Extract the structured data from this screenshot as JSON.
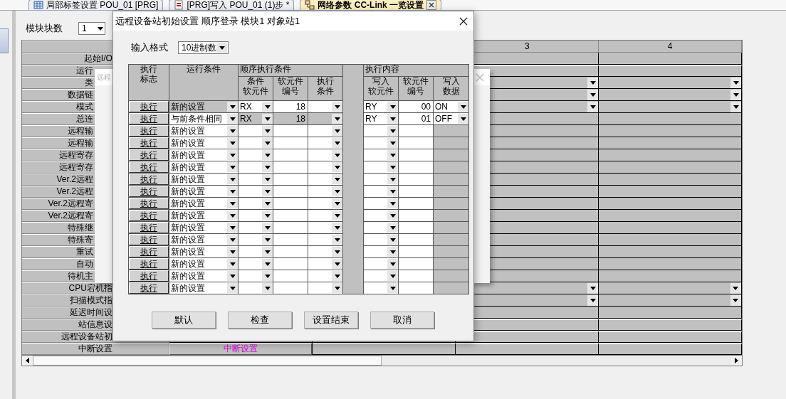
{
  "tabs": [
    {
      "label": "局部标签设置 POU_01 [PRG]",
      "kind": "table",
      "selected": false
    },
    {
      "label": "[PRG]写入 POU_01 (1)步 *",
      "kind": "program",
      "selected": false
    },
    {
      "label": "网络参数 CC-Link 一览设置",
      "kind": "network",
      "selected": true
    }
  ],
  "module_count": {
    "label": "模块块数",
    "value": "1"
  },
  "grid": {
    "station_columns": [
      "3",
      "4"
    ],
    "rows": [
      {
        "label": "起始I/O",
        "kind": "plain"
      },
      {
        "label": "运行",
        "kind": "button"
      },
      {
        "label": "类",
        "kind": "dropdown"
      },
      {
        "label": "数据链",
        "kind": "dropdown"
      },
      {
        "label": "模式",
        "kind": "dropdown"
      },
      {
        "label": "总连",
        "kind": "plain"
      },
      {
        "label": "远程输",
        "kind": "plain"
      },
      {
        "label": "远程输",
        "kind": "plain"
      },
      {
        "label": "远程寄存",
        "kind": "plain"
      },
      {
        "label": "远程寄存",
        "kind": "plain"
      },
      {
        "label": "Ver.2远程",
        "kind": "plain"
      },
      {
        "label": "Ver.2远程",
        "kind": "plain"
      },
      {
        "label": "Ver.2远程寄",
        "kind": "plain"
      },
      {
        "label": "Ver.2远程寄",
        "kind": "plain"
      },
      {
        "label": "特殊继",
        "kind": "plain"
      },
      {
        "label": "特殊寄",
        "kind": "plain"
      },
      {
        "label": "重试",
        "kind": "plain"
      },
      {
        "label": "自动",
        "kind": "plain"
      },
      {
        "label": "待机主",
        "kind": "plain"
      },
      {
        "label": "CPU宕机指",
        "kind": "dropdown"
      },
      {
        "label": "扫描模式指",
        "kind": "dropdown"
      },
      {
        "label": "延迟时间设",
        "kind": "plain"
      },
      {
        "label": "站信息设",
        "kind": "button"
      },
      {
        "label": "远程设备站初",
        "kind": "button"
      },
      {
        "label": "中断设置",
        "kind": "button",
        "link": "中断设置"
      }
    ]
  },
  "background_dialog": {
    "title": "远程"
  },
  "dialog": {
    "title": "远程设备站初始设置 顺序登录  模块1 对象站1",
    "input_format": {
      "label": "输入格式",
      "value": "10进制数"
    },
    "headers": {
      "flag": [
        "执行",
        "标志"
      ],
      "run_condition": [
        "运行条件"
      ],
      "sequence": [
        "顺序执行条件"
      ],
      "cond_device": [
        "条件",
        "软元件"
      ],
      "cond_number": [
        "软元件",
        "编号"
      ],
      "exec_condition": [
        "执行",
        "条件"
      ],
      "content": [
        "执行内容"
      ],
      "write_device": [
        "写入",
        "软元件"
      ],
      "write_number": [
        "软元件",
        "编号"
      ],
      "write_data": [
        "写入",
        "数据"
      ]
    },
    "rows": [
      {
        "flag": "执行",
        "run_condition": "新的设置",
        "selected": true,
        "cond_device": "RX",
        "cond_number": "18",
        "cond_disabled": false,
        "write_device": "RY",
        "write_number": "00",
        "write_data": "ON",
        "write_data_disabled": false
      },
      {
        "flag": "执行",
        "run_condition": "与前条件相同",
        "selected": false,
        "cond_device": "RX",
        "cond_number": "18",
        "cond_disabled": true,
        "write_device": "RY",
        "write_number": "01",
        "write_data": "OFF",
        "write_data_disabled": false
      },
      {
        "flag": "执行",
        "run_condition": "新的设置",
        "selected": false,
        "cond_disabled": false,
        "write_data_disabled": true
      },
      {
        "flag": "执行",
        "run_condition": "新的设置",
        "selected": false,
        "cond_disabled": false,
        "write_data_disabled": true
      },
      {
        "flag": "执行",
        "run_condition": "新的设置",
        "selected": false,
        "cond_disabled": false,
        "write_data_disabled": true
      },
      {
        "flag": "执行",
        "run_condition": "新的设置",
        "selected": false,
        "cond_disabled": false,
        "write_data_disabled": true
      },
      {
        "flag": "执行",
        "run_condition": "新的设置",
        "selected": false,
        "cond_disabled": false,
        "write_data_disabled": true
      },
      {
        "flag": "执行",
        "run_condition": "新的设置",
        "selected": false,
        "cond_disabled": false,
        "write_data_disabled": true
      },
      {
        "flag": "执行",
        "run_condition": "新的设置",
        "selected": false,
        "cond_disabled": false,
        "write_data_disabled": true
      },
      {
        "flag": "执行",
        "run_condition": "新的设置",
        "selected": false,
        "cond_disabled": false,
        "write_data_disabled": true
      },
      {
        "flag": "执行",
        "run_condition": "新的设置",
        "selected": false,
        "cond_disabled": false,
        "write_data_disabled": true
      },
      {
        "flag": "执行",
        "run_condition": "新的设置",
        "selected": false,
        "cond_disabled": false,
        "write_data_disabled": true
      },
      {
        "flag": "执行",
        "run_condition": "新的设置",
        "selected": false,
        "cond_disabled": false,
        "write_data_disabled": true
      },
      {
        "flag": "执行",
        "run_condition": "新的设置",
        "selected": false,
        "cond_disabled": false,
        "write_data_disabled": true
      },
      {
        "flag": "执行",
        "run_condition": "新的设置",
        "selected": false,
        "cond_disabled": false,
        "write_data_disabled": true
      },
      {
        "flag": "执行",
        "run_condition": "新的设置",
        "selected": false,
        "cond_disabled": false,
        "write_data_disabled": true
      }
    ],
    "buttons": [
      "默认",
      "检查",
      "设置结束",
      "取消"
    ]
  }
}
